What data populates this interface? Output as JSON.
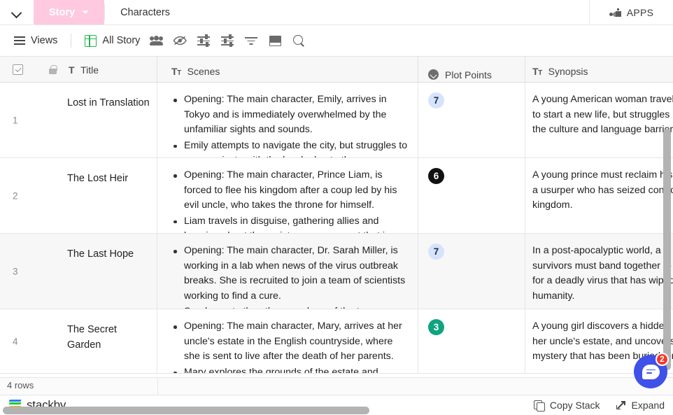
{
  "tabbar": {
    "collapse_icon": "chevron-down-icon",
    "tabs": [
      {
        "label": "Story",
        "active": true,
        "caret": true
      },
      {
        "label": "Characters",
        "active": false,
        "caret": false
      }
    ],
    "apps_label": "APPS",
    "active_tab_bg": "#ffc9e0"
  },
  "toolbar": {
    "views_label": "Views",
    "view_name": "All Story",
    "icons": [
      "hamburger-icon",
      "grid-view-icon",
      "collaborators-icon",
      "hide-fields-icon",
      "group-icon",
      "sort-icon",
      "filter-icon",
      "row-height-icon",
      "search-icon"
    ],
    "grid_icon_color": "#25b34b"
  },
  "grid": {
    "columns": [
      {
        "key": "title",
        "label": "Title",
        "field_icon": "single-line-text-icon"
      },
      {
        "key": "scenes",
        "label": "Scenes",
        "field_icon": "long-text-icon"
      },
      {
        "key": "plot_points",
        "label": "Plot Points",
        "field_icon": "single-select-icon"
      },
      {
        "key": "synopsis",
        "label": "Synopsis",
        "field_icon": "long-text-icon"
      }
    ],
    "rows": [
      {
        "num": "1",
        "title": "Lost in Translation",
        "scenes": [
          "Opening: The main character, Emily, arrives in Tokyo and is immediately overwhelmed by the unfamiliar sights and sounds.",
          "Emily attempts to navigate the city, but struggles to communicate with the locals due to the"
        ],
        "plot_points": {
          "value": "7",
          "bg": "#d6e4fb",
          "fg": "#1f2b4d"
        },
        "synopsis": [
          "A young American woman travels",
          "to start a new life, but struggles",
          "the culture and language barriers"
        ],
        "highlight": false
      },
      {
        "num": "2",
        "title": "The Lost Heir",
        "scenes": [
          "Opening: The main character, Prince Liam, is forced to flee his kingdom after a coup led by his evil uncle, who takes the throne for himself.",
          "Liam travels in disguise, gathering allies and learning about the resistance movement that is"
        ],
        "plot_points": {
          "value": "6",
          "bg": "#111111",
          "fg": "#ffffff"
        },
        "synopsis": [
          "A young prince must reclaim his",
          "a usurper who has seized control",
          "kingdom."
        ],
        "highlight": false
      },
      {
        "num": "3",
        "title": "The Last Hope",
        "scenes": [
          "Opening: The main character, Dr. Sarah Miller, is working in a lab when news of the virus outbreak breaks. She is recruited to join a team of scientists working to find a cure.",
          "Sarah meets the other members of the team."
        ],
        "plot_points": {
          "value": "7",
          "bg": "#d6e4fb",
          "fg": "#1f2b4d"
        },
        "synopsis": [
          "In a post-apocalyptic world, a s",
          "survivors must band together to",
          "for a deadly virus that has wiped",
          "humanity."
        ],
        "highlight": true
      },
      {
        "num": "4",
        "title": "The Secret Garden",
        "scenes": [
          "Opening: The main character, Mary, arrives at her uncle's estate in the English countryside, where she is sent to live after the death of her parents.",
          "Mary explores the grounds of the estate and"
        ],
        "plot_points": {
          "value": "3",
          "bg": "#10a37f",
          "fg": "#ffffff"
        },
        "synopsis": [
          "A young girl discovers a hidden",
          "her uncle's estate, and uncovers",
          "mystery that has been buried for"
        ],
        "highlight": false
      }
    ],
    "row_count_label": "4 rows"
  },
  "footer": {
    "brand": "stackby",
    "copy_stack_label": "Copy Stack",
    "expand_label": "Expand"
  },
  "chat": {
    "unread_count": "2",
    "color": "#3f51e8",
    "badge_color": "#f2392c"
  }
}
